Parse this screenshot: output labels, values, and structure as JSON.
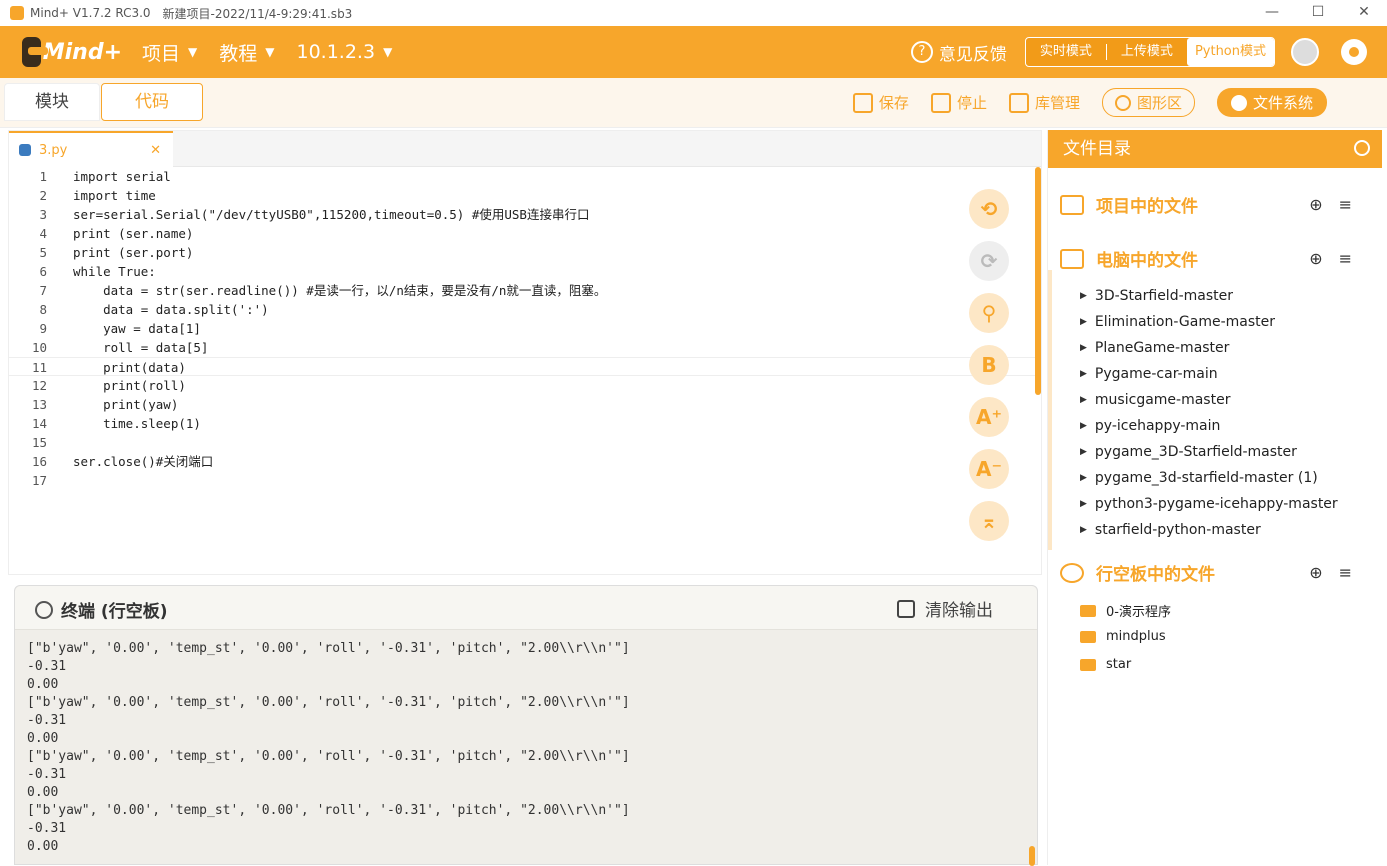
{
  "window": {
    "app_title": "Mind+ V1.7.2 RC3.0",
    "project_title": "新建项目-2022/11/4-9:29:41.sb3",
    "minimize": "—",
    "maximize": "☐",
    "close": "✕"
  },
  "menubar": {
    "logo": "Mind+",
    "project": "项目",
    "tutorial": "教程",
    "device": "10.1.2.3",
    "feedback": "意见反馈",
    "modes": [
      "实时模式",
      "上传模式",
      "Python模式"
    ]
  },
  "toolbar": {
    "tab_blocks": "模块",
    "tab_code": "代码",
    "save": "保存",
    "stop": "停止",
    "library": "库管理",
    "graphics": "图形区",
    "filesystem": "文件系统"
  },
  "editor": {
    "file_tab": "3.py",
    "close_tab": "✕",
    "lines": [
      {
        "num": "1",
        "text": "import serial"
      },
      {
        "num": "2",
        "text": "import time"
      },
      {
        "num": "3",
        "text": "ser=serial.Serial(\"/dev/ttyUSB0\",115200,timeout=0.5) #使用USB连接串行口"
      },
      {
        "num": "4",
        "text": "print (ser.name)"
      },
      {
        "num": "5",
        "text": "print (ser.port)"
      },
      {
        "num": "6",
        "text": "while True:"
      },
      {
        "num": "7",
        "text": "    data = str(ser.readline()) #是读一行，以/n结束，要是没有/n就一直读，阻塞。"
      },
      {
        "num": "8",
        "text": "    data = data.split(':')"
      },
      {
        "num": "9",
        "text": "    yaw = data[1]"
      },
      {
        "num": "10",
        "text": "    roll = data[5]"
      },
      {
        "num": "11",
        "text": "    print(data)"
      },
      {
        "num": "12",
        "text": "    print(roll)"
      },
      {
        "num": "13",
        "text": "    print(yaw)"
      },
      {
        "num": "14",
        "text": "    time.sleep(1)"
      },
      {
        "num": "15",
        "text": ""
      },
      {
        "num": "16",
        "text": "ser.close()#关闭端口"
      },
      {
        "num": "17",
        "text": ""
      }
    ],
    "fab_undo": "⟲",
    "fab_redo": "⟳",
    "fab_search": "⚲",
    "fab_format": "B",
    "fab_font_up": "A⁺",
    "fab_font_down": "A⁻",
    "fab_top": "⌅"
  },
  "terminal": {
    "title": "终端 (行空板)",
    "clear": "清除输出",
    "output": "[\"b'yaw\", '0.00', 'temp_st', '0.00', 'roll', '-0.31', 'pitch', \"2.00\\\\r\\\\n'\"]\n-0.31\n0.00\n[\"b'yaw\", '0.00', 'temp_st', '0.00', 'roll', '-0.31', 'pitch', \"2.00\\\\r\\\\n'\"]\n-0.31\n0.00\n[\"b'yaw\", '0.00', 'temp_st', '0.00', 'roll', '-0.31', 'pitch', \"2.00\\\\r\\\\n'\"]\n-0.31\n0.00\n[\"b'yaw\", '0.00', 'temp_st', '0.00', 'roll', '-0.31', 'pitch', \"2.00\\\\r\\\\n'\"]\n-0.31\n0.00"
  },
  "filepanel": {
    "title": "文件目录",
    "project_files": "项目中的文件",
    "computer_files": "电脑中的文件",
    "board_files": "行空板中的文件",
    "add": "⊕",
    "menu": "≡",
    "computer_folders": [
      "3D-Starfield-master",
      "Elimination-Game-master",
      "PlaneGame-master",
      "Pygame-car-main",
      "musicgame-master",
      "py-icehappy-main",
      "pygame_3D-Starfield-master",
      "pygame_3d-starfield-master (1)",
      "python3-pygame-icehappy-master",
      "starfield-python-master"
    ],
    "board_folders": [
      "0-演示程序",
      "mindplus",
      "star"
    ]
  },
  "colors": {
    "accent": "#f7a62b",
    "terminal_bg": "#f0eee9"
  }
}
